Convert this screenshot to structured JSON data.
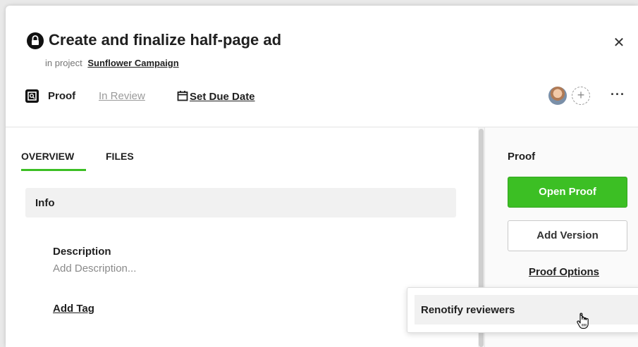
{
  "header": {
    "title": "Create and finalize half-page ad",
    "project_prefix": "in project",
    "project_name": "Sunflower Campaign",
    "close_glyph": "✕"
  },
  "status_row": {
    "type_label": "Proof",
    "status": "In Review",
    "due_date_label": "Set Due Date",
    "add_person_glyph": "+",
    "more_glyph": "···"
  },
  "tabs": [
    {
      "label": "OVERVIEW",
      "active": true
    },
    {
      "label": "FILES",
      "active": false
    }
  ],
  "info": {
    "section_title": "Info",
    "description_label": "Description",
    "description_placeholder": "Add Description...",
    "add_tag_label": "Add Tag"
  },
  "proof_panel": {
    "heading": "Proof",
    "open_proof_label": "Open Proof",
    "add_version_label": "Add Version",
    "options_label": "Proof Options"
  },
  "dropdown": {
    "items": [
      {
        "label": "Renotify reviewers"
      }
    ]
  },
  "colors": {
    "accent_green": "#3cbf24",
    "muted_text": "#8a8a8a",
    "panel_gray": "#f1f1f1"
  },
  "icons": [
    "lock-icon",
    "close-icon",
    "proof-icon",
    "calendar-icon",
    "avatar",
    "add-person-icon",
    "more-icon",
    "hand-cursor-icon"
  ]
}
